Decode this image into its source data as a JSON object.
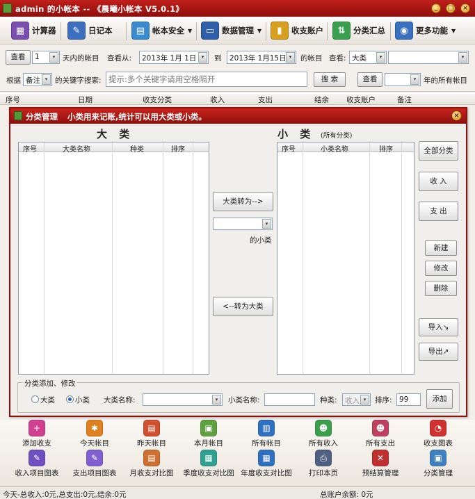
{
  "window": {
    "title": "admin 的小帐本 -- 《晨曦小帐本 V5.0.1》",
    "min_glyph": "_",
    "max_glyph": "□",
    "close_glyph": "×"
  },
  "toolbar": {
    "items": [
      {
        "label": "计算器",
        "icon": "calculator-icon",
        "color": "#7a4fb0",
        "glyph": "▦"
      },
      {
        "label": "日记本",
        "icon": "notebook-icon",
        "color": "#3d6fc0",
        "glyph": "✎"
      },
      {
        "label": "帐本安全",
        "icon": "safe-icon",
        "color": "#3a8ad0",
        "glyph": "▤",
        "arrow": "▼"
      },
      {
        "label": "数据管理",
        "icon": "monitor-icon",
        "color": "#2f5fa8",
        "glyph": "▭",
        "arrow": "▼"
      },
      {
        "label": "收支账户",
        "icon": "bar-chart-icon",
        "color": "#d8a020",
        "glyph": "▮"
      },
      {
        "label": "分类汇总",
        "icon": "arrows-icon",
        "color": "#3aa050",
        "glyph": "⇅"
      },
      {
        "label": "更多功能",
        "icon": "globe-icon",
        "color": "#3a70c0",
        "glyph": "◉",
        "arrow": "▼"
      }
    ]
  },
  "filter1": {
    "view_label": "查看",
    "days_value": "1",
    "days_label": "天内的帐目",
    "from_label": "查看从:",
    "from_date": "2013年 1月 1日",
    "to_label": "到",
    "to_date": "2013年 1月15日",
    "tail_label": "的帐目",
    "see_label": "查看:",
    "category_value": "大类",
    "category_sub": "",
    "dropdown_glyph": "▾"
  },
  "filter2": {
    "by_label": "根据",
    "field_value": "备注",
    "keyword_label": "的关键字搜索:",
    "search_placeholder": "提示:多个关键字请用空格隔开",
    "search_button": "搜 索",
    "view_button": "查看",
    "year_value": "",
    "year_label": "年的所有帐目"
  },
  "grid": {
    "columns": [
      "序号",
      "日期",
      "收支分类",
      "收入",
      "支出",
      "结余",
      "收支账户",
      "备注"
    ]
  },
  "dialog": {
    "title": "分类管理",
    "subtitle": "小类用来记账,统计可以用大类或小类。",
    "close_glyph": "×",
    "big": {
      "title": "大 类",
      "columns": [
        "序号",
        "大类名称",
        "种类",
        "排序"
      ]
    },
    "small": {
      "title": "小 类",
      "hint": "(所有分类)",
      "columns": [
        "序号",
        "小类名称",
        "排序"
      ]
    },
    "to_small_button": "大类转为-->",
    "mid_select_value": "",
    "of_small_label": "的小类",
    "to_big_button": "<--转为大类",
    "right_buttons": {
      "all": "全部分类",
      "income": "收 入",
      "expense": "支 出",
      "new": "新建",
      "edit": "修改",
      "delete": "删除",
      "import": "导入↘",
      "export": "导出↗"
    },
    "form": {
      "legend": "分类添加、修改",
      "radio_big": "大类",
      "radio_small": "小类",
      "selected": "小类",
      "big_name_label": "大类名称:",
      "big_name_value": "",
      "small_name_label": "小类名称:",
      "small_name_value": "",
      "kind_label": "种类:",
      "kind_value": "收入",
      "order_label": "排序:",
      "order_value": "99",
      "add_button": "添加"
    }
  },
  "shortcuts": {
    "row1": [
      {
        "label": "添加收支",
        "icon": "add-record-icon",
        "color": "#d04090",
        "glyph": "+"
      },
      {
        "label": "今天帐目",
        "icon": "today-icon",
        "color": "#e08020",
        "glyph": "✱"
      },
      {
        "label": "昨天帐目",
        "icon": "yesterday-icon",
        "color": "#d05030",
        "glyph": "▤"
      },
      {
        "label": "本月帐目",
        "icon": "month-icon",
        "color": "#60a040",
        "glyph": "▣"
      },
      {
        "label": "所有帐目",
        "icon": "all-records-icon",
        "color": "#3070c0",
        "glyph": "▥"
      },
      {
        "label": "所有收入",
        "icon": "all-income-icon",
        "color": "#3aa050",
        "glyph": "☻"
      },
      {
        "label": "所有支出",
        "icon": "all-expense-icon",
        "color": "#c04060",
        "glyph": "☻"
      },
      {
        "label": "收支图表",
        "icon": "pie-chart-icon",
        "color": "#d03030",
        "glyph": "◔"
      }
    ],
    "row2": [
      {
        "label": "收入项目图表",
        "icon": "income-chart-icon",
        "color": "#7050c0",
        "glyph": "✎"
      },
      {
        "label": "支出项目图表",
        "icon": "expense-chart-icon",
        "color": "#8060d0",
        "glyph": "✎"
      },
      {
        "label": "月收支对比图",
        "icon": "monthly-compare-icon",
        "color": "#d07030",
        "glyph": "▤"
      },
      {
        "label": "季度收支对比图",
        "icon": "quarterly-compare-icon",
        "color": "#30a090",
        "glyph": "▦"
      },
      {
        "label": "年度收支对比图",
        "icon": "yearly-compare-icon",
        "color": "#3070c0",
        "glyph": "▦"
      },
      {
        "label": "打印本页",
        "icon": "print-icon",
        "color": "#506080",
        "glyph": "⎙"
      },
      {
        "label": "预结算管理",
        "icon": "tools-icon",
        "color": "#c03030",
        "glyph": "✕"
      },
      {
        "label": "分类管理",
        "icon": "category-icon",
        "color": "#4080c0",
        "glyph": "▣"
      }
    ]
  },
  "status": {
    "summary": "今天-总收入:0元,总支出:0元,结余:0元",
    "balance": "总账户余额: 0元"
  }
}
